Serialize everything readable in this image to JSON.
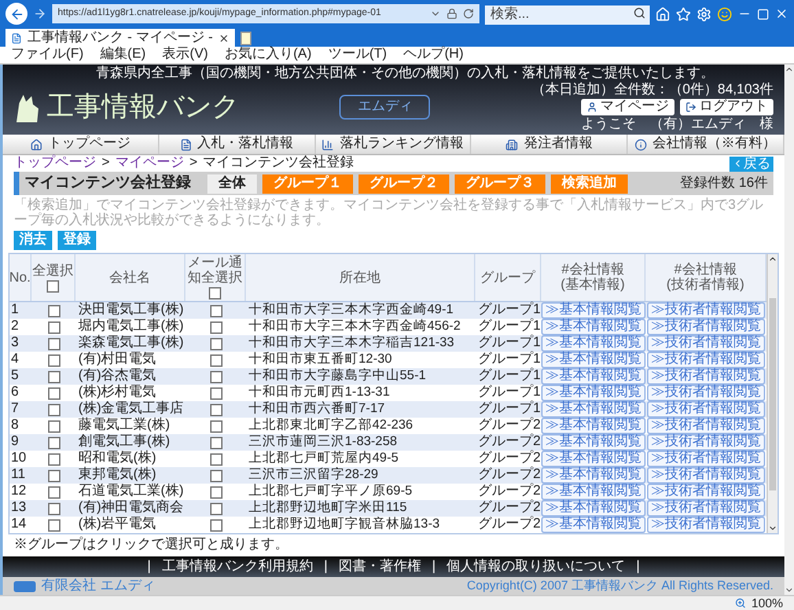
{
  "browser": {
    "url": "https://ad1l1yg8r1.cnatrelease.jp/kouji/mypage_information.php#mypage-01",
    "search": {
      "placeholder": "検索..."
    },
    "tab": "工事情報バンク - マイページ -",
    "menu": [
      "ファイル(F)",
      "編集(E)",
      "表示(V)",
      "お気に入り(A)",
      "ツール(T)",
      "ヘルプ(H)"
    ],
    "zoom": "100%"
  },
  "header": {
    "notice": "青森県内全工事（国の機関・地方公共団体・その他の機関）の入札・落札情報をご提供いたします。",
    "count": "（本日追加）全件数：（0件）84,103件",
    "logo": "工事情報バンク",
    "company_button": "エムディ",
    "mypage_button": "マイページ",
    "logout_button": "ログアウト",
    "welcome": "ようこそ　（有）エムディ　様"
  },
  "nav": [
    "トップページ",
    "入札・落札情報",
    "落札ランキング情報",
    "発注者情報",
    "会社情報（※有料）"
  ],
  "breadcrumb": {
    "items": [
      "トップページ",
      "マイページ",
      "マイコンテンツ会社登録"
    ],
    "separator": ">"
  },
  "back_button": "戻る",
  "section": {
    "title": "マイコンテンツ会社登録",
    "tabs": [
      {
        "label": "全体",
        "selected": true
      },
      {
        "label": "グループ１",
        "selected": false
      },
      {
        "label": "グループ２",
        "selected": false
      },
      {
        "label": "グループ３",
        "selected": false
      },
      {
        "label": "検索追加",
        "selected": false
      }
    ],
    "count": "登録件数 16件"
  },
  "description": "「検索追加」でマイコンテンツ会社登録ができます。マイコンテンツ会社を登録する事で「入札情報サービス」内で3グループ毎の入札状況や比較ができるようになります。",
  "actions": [
    "消去",
    "登録"
  ],
  "table": {
    "columns": [
      "No.",
      "全選択",
      "会社名",
      "メール通知全選択",
      "所在地",
      "グループ",
      "#会社情報\n(基本情報)",
      "#会社情報\n(技術者情報)"
    ],
    "select_all": false,
    "mail_select_all": false,
    "rows": [
      {
        "no": "1",
        "checked": false,
        "name": "決田電気工事(株)",
        "mail": false,
        "address": "十和田市大字三本木字西金崎49-1",
        "group": "グループ1",
        "info_button": "≫基本情報閲覧",
        "tech_button": "≫技術者情報閲覧"
      },
      {
        "no": "2",
        "checked": false,
        "name": "堀内電気工事(株)",
        "mail": false,
        "address": "十和田市大字三本木字西金崎456-2",
        "group": "グループ1",
        "info_button": "≫基本情報閲覧",
        "tech_button": "≫技術者情報閲覧"
      },
      {
        "no": "3",
        "checked": false,
        "name": "楽森電気工事(株)",
        "mail": false,
        "address": "十和田市大字三本木字稲吉121-33",
        "group": "グループ1",
        "info_button": "≫基本情報閲覧",
        "tech_button": "≫技術者情報閲覧"
      },
      {
        "no": "4",
        "checked": false,
        "name": "(有)村田電気",
        "mail": false,
        "address": "十和田市東五番町12-30",
        "group": "グループ1",
        "info_button": "≫基本情報閲覧",
        "tech_button": "≫技術者情報閲覧"
      },
      {
        "no": "5",
        "checked": false,
        "name": "(有)谷杰電気",
        "mail": false,
        "address": "十和田市大字藤島字中山55-1",
        "group": "グループ1",
        "info_button": "≫基本情報閲覧",
        "tech_button": "≫技術者情報閲覧"
      },
      {
        "no": "6",
        "checked": false,
        "name": "(株)杉村電気",
        "mail": false,
        "address": "十和田市元町西1-13-31",
        "group": "グループ1",
        "info_button": "≫基本情報閲覧",
        "tech_button": "≫技術者情報閲覧"
      },
      {
        "no": "7",
        "checked": false,
        "name": "(株)金電気工事店",
        "mail": false,
        "address": "十和田市西六番町7-17",
        "group": "グループ1",
        "info_button": "≫基本情報閲覧",
        "tech_button": "≫技術者情報閲覧"
      },
      {
        "no": "8",
        "checked": false,
        "name": "藤電気工業(株)",
        "mail": false,
        "address": "上北郡東北町字乙部42-236",
        "group": "グループ2",
        "info_button": "≫基本情報閲覧",
        "tech_button": "≫技術者情報閲覧"
      },
      {
        "no": "9",
        "checked": false,
        "name": "創電気工事(株)",
        "mail": false,
        "address": "三沢市蓮岡三沢1-83-258",
        "group": "グループ2",
        "info_button": "≫基本情報閲覧",
        "tech_button": "≫技術者情報閲覧"
      },
      {
        "no": "10",
        "checked": false,
        "name": "昭和電気(株)",
        "mail": false,
        "address": "上北郡七戸町荒屋内49-5",
        "group": "グループ2",
        "info_button": "≫基本情報閲覧",
        "tech_button": "≫技術者情報閲覧"
      },
      {
        "no": "11",
        "checked": false,
        "name": "東邦電気(株)",
        "mail": false,
        "address": "三沢市三沢留字28-29",
        "group": "グループ2",
        "info_button": "≫基本情報閲覧",
        "tech_button": "≫技術者情報閲覧"
      },
      {
        "no": "12",
        "checked": false,
        "name": "石道電気工業(株)",
        "mail": false,
        "address": "上北郡七戸町字平ノ原69-5",
        "group": "グループ2",
        "info_button": "≫基本情報閲覧",
        "tech_button": "≫技術者情報閲覧"
      },
      {
        "no": "13",
        "checked": false,
        "name": "(有)神田電気商会",
        "mail": false,
        "address": "上北郡野辺地町字米田115",
        "group": "グループ2",
        "info_button": "≫基本情報閲覧",
        "tech_button": "≫技術者情報閲覧"
      },
      {
        "no": "14",
        "checked": false,
        "name": "(株)岩平電気",
        "mail": false,
        "address": "上北郡野辺地町字観音林脇13-3",
        "group": "グループ2",
        "info_button": "≫基本情報閲覧",
        "tech_button": "≫技術者情報閲覧"
      }
    ]
  },
  "note": "※グループはクリックで選択可と成ります。",
  "footer": {
    "links": [
      "工事情報バンク利用規約",
      "図書・著作権",
      "個人情報の取り扱いについて"
    ],
    "separator": "|",
    "company": "有限会社 エムディ",
    "copyright": "Copyright(C) 2007 工事情報バンク All Rights Reserved."
  }
}
